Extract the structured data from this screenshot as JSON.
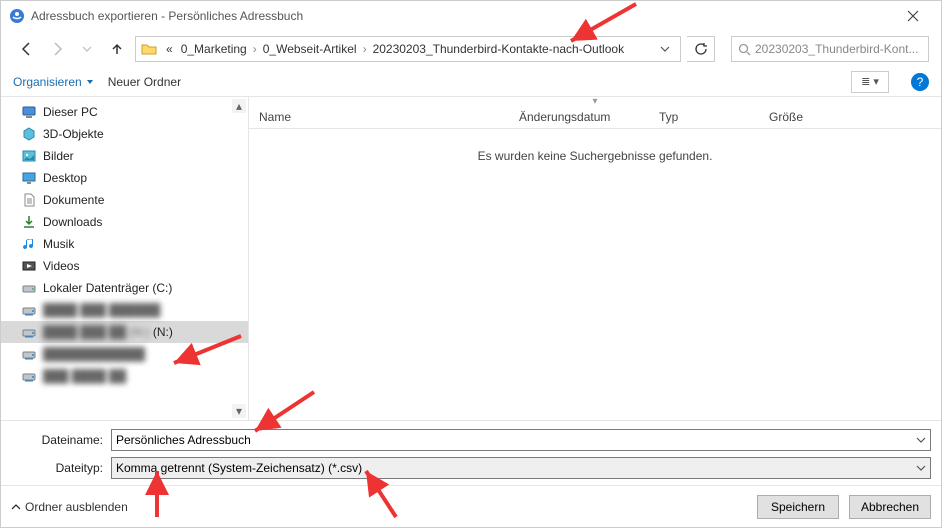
{
  "title": "Adressbuch exportieren - Persönliches Adressbuch",
  "breadcrumb": {
    "root_chevrons": "«",
    "items": [
      "0_Marketing",
      "0_Webseit-Artikel",
      "20230203_Thunderbird-Kontakte-nach-Outlook"
    ]
  },
  "search": {
    "placeholder": "20230203_Thunderbird-Kont..."
  },
  "toolbar": {
    "organize": "Organisieren",
    "new_folder": "Neuer Ordner",
    "view_glyph": "≣ ▾",
    "help_glyph": "?"
  },
  "tree": {
    "items": [
      {
        "icon": "pc",
        "label": "Dieser PC"
      },
      {
        "icon": "cube",
        "label": "3D-Objekte"
      },
      {
        "icon": "pictures",
        "label": "Bilder"
      },
      {
        "icon": "desktop",
        "label": "Desktop"
      },
      {
        "icon": "docs",
        "label": "Dokumente"
      },
      {
        "icon": "download",
        "label": "Downloads"
      },
      {
        "icon": "music",
        "label": "Musik"
      },
      {
        "icon": "videos",
        "label": "Videos"
      },
      {
        "icon": "drive",
        "label": "Lokaler Datenträger (C:)"
      },
      {
        "icon": "netdrive",
        "label": "████ ███ ██████",
        "blur": true
      },
      {
        "icon": "netdrive",
        "label": "████ ███ ██ (N:)",
        "blur": true,
        "selected": true,
        "suffix": " (N:)"
      },
      {
        "icon": "netdrive",
        "label": "████████████",
        "blur": true
      },
      {
        "icon": "netdrive",
        "label": "███ ████ ██",
        "blur": true
      }
    ]
  },
  "columns": {
    "name": "Name",
    "modified": "Änderungsdatum",
    "type": "Typ",
    "size": "Größe"
  },
  "empty_text": "Es wurden keine Suchergebnisse gefunden.",
  "form": {
    "filename_label": "Dateiname:",
    "filename_value": "Persönliches Adressbuch",
    "filetype_label": "Dateityp:",
    "filetype_value": "Komma getrennt (System-Zeichensatz) (*.csv)"
  },
  "footer": {
    "hide_folders": "Ordner ausblenden",
    "save": "Speichern",
    "cancel": "Abbrechen"
  }
}
